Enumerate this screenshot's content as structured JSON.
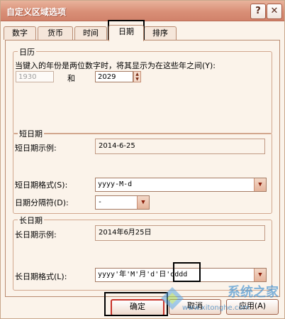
{
  "window": {
    "title": "自定义区域选项",
    "help_icon": "?",
    "close_icon": "✕"
  },
  "tabs": [
    "数字",
    "货币",
    "时间",
    "日期",
    "排序"
  ],
  "calendar": {
    "legend": "日历",
    "description": "当键入的年份是两位数字时，将其显示为在这些年之间(Y):",
    "from_year": "1930",
    "and_label": "和",
    "to_year": "2029"
  },
  "short_date": {
    "legend": "短日期",
    "sample_label": "短日期示例:",
    "sample_value": "2014-6-25",
    "format_label": "短日期格式(S):",
    "format_value": "yyyy-M-d",
    "separator_label": "日期分隔符(D):",
    "separator_value": "-"
  },
  "long_date": {
    "legend": "长日期",
    "sample_label": "长日期示例:",
    "sample_value": "2014年6月25日",
    "format_label": "长日期格式(L):",
    "format_value": "yyyy'年'M'月'd'日'dddd"
  },
  "buttons": {
    "ok": "确定",
    "cancel": "取消",
    "apply": "应用(A)"
  },
  "watermark": {
    "brand": "系统之家",
    "url": "www.xitonghe.com"
  }
}
